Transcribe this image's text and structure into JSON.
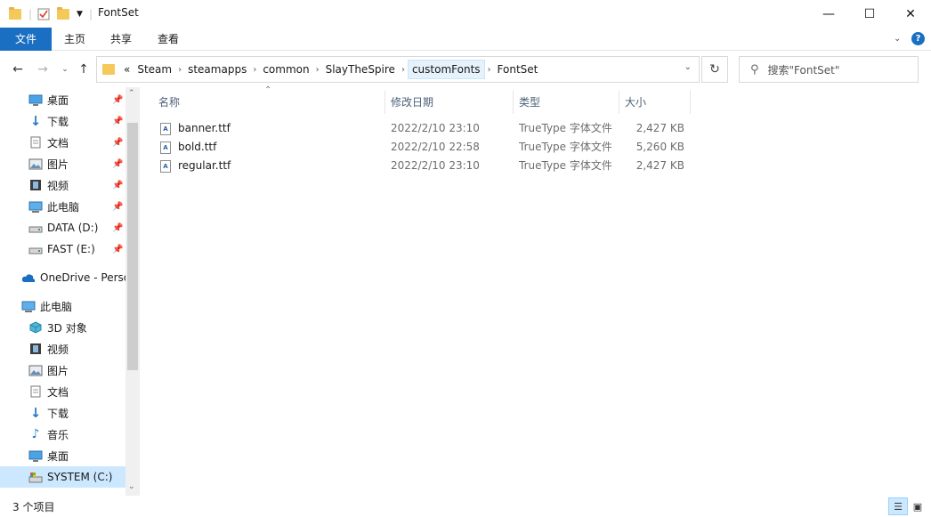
{
  "window": {
    "title": "FontSet",
    "minimize": "—",
    "maximize": "☐",
    "close": "✕"
  },
  "ribbon": {
    "tabs": [
      "文件",
      "主页",
      "共享",
      "查看"
    ]
  },
  "address": {
    "overflow": "«",
    "crumbs": [
      "Steam",
      "steamapps",
      "common",
      "SlayTheSpire",
      "customFonts",
      "FontSet"
    ],
    "search_placeholder": "搜索\"FontSet\""
  },
  "nav": {
    "quick_access": [
      {
        "label": "桌面",
        "icon": "desktop-icon"
      },
      {
        "label": "下载",
        "icon": "download-icon"
      },
      {
        "label": "文档",
        "icon": "document-icon"
      },
      {
        "label": "图片",
        "icon": "picture-icon"
      },
      {
        "label": "视频",
        "icon": "video-icon"
      },
      {
        "label": "此电脑",
        "icon": "computer-icon"
      },
      {
        "label": "DATA (D:)",
        "icon": "drive-icon"
      },
      {
        "label": "FAST (E:)",
        "icon": "drive-icon"
      }
    ],
    "onedrive": "OneDrive - Perso",
    "this_pc": "此电脑",
    "pc_items": [
      {
        "label": "3D 对象",
        "icon": "3d-objects-icon"
      },
      {
        "label": "视频",
        "icon": "video-icon"
      },
      {
        "label": "图片",
        "icon": "picture-icon"
      },
      {
        "label": "文档",
        "icon": "document-icon"
      },
      {
        "label": "下载",
        "icon": "download-icon"
      },
      {
        "label": "音乐",
        "icon": "music-icon"
      },
      {
        "label": "桌面",
        "icon": "desktop-icon"
      },
      {
        "label": "SYSTEM (C:)",
        "icon": "system-drive-icon"
      }
    ]
  },
  "columns": {
    "name": "名称",
    "date": "修改日期",
    "type": "类型",
    "size": "大小"
  },
  "files": [
    {
      "name": "banner.ttf",
      "date": "2022/2/10 23:10",
      "type": "TrueType 字体文件",
      "size": "2,427 KB"
    },
    {
      "name": "bold.ttf",
      "date": "2022/2/10 22:58",
      "type": "TrueType 字体文件",
      "size": "5,260 KB"
    },
    {
      "name": "regular.ttf",
      "date": "2022/2/10 23:10",
      "type": "TrueType 字体文件",
      "size": "2,427 KB"
    }
  ],
  "status": {
    "count": "3 个项目"
  },
  "colors": {
    "accent": "#1a6fc2",
    "selection": "#cce8ff"
  }
}
